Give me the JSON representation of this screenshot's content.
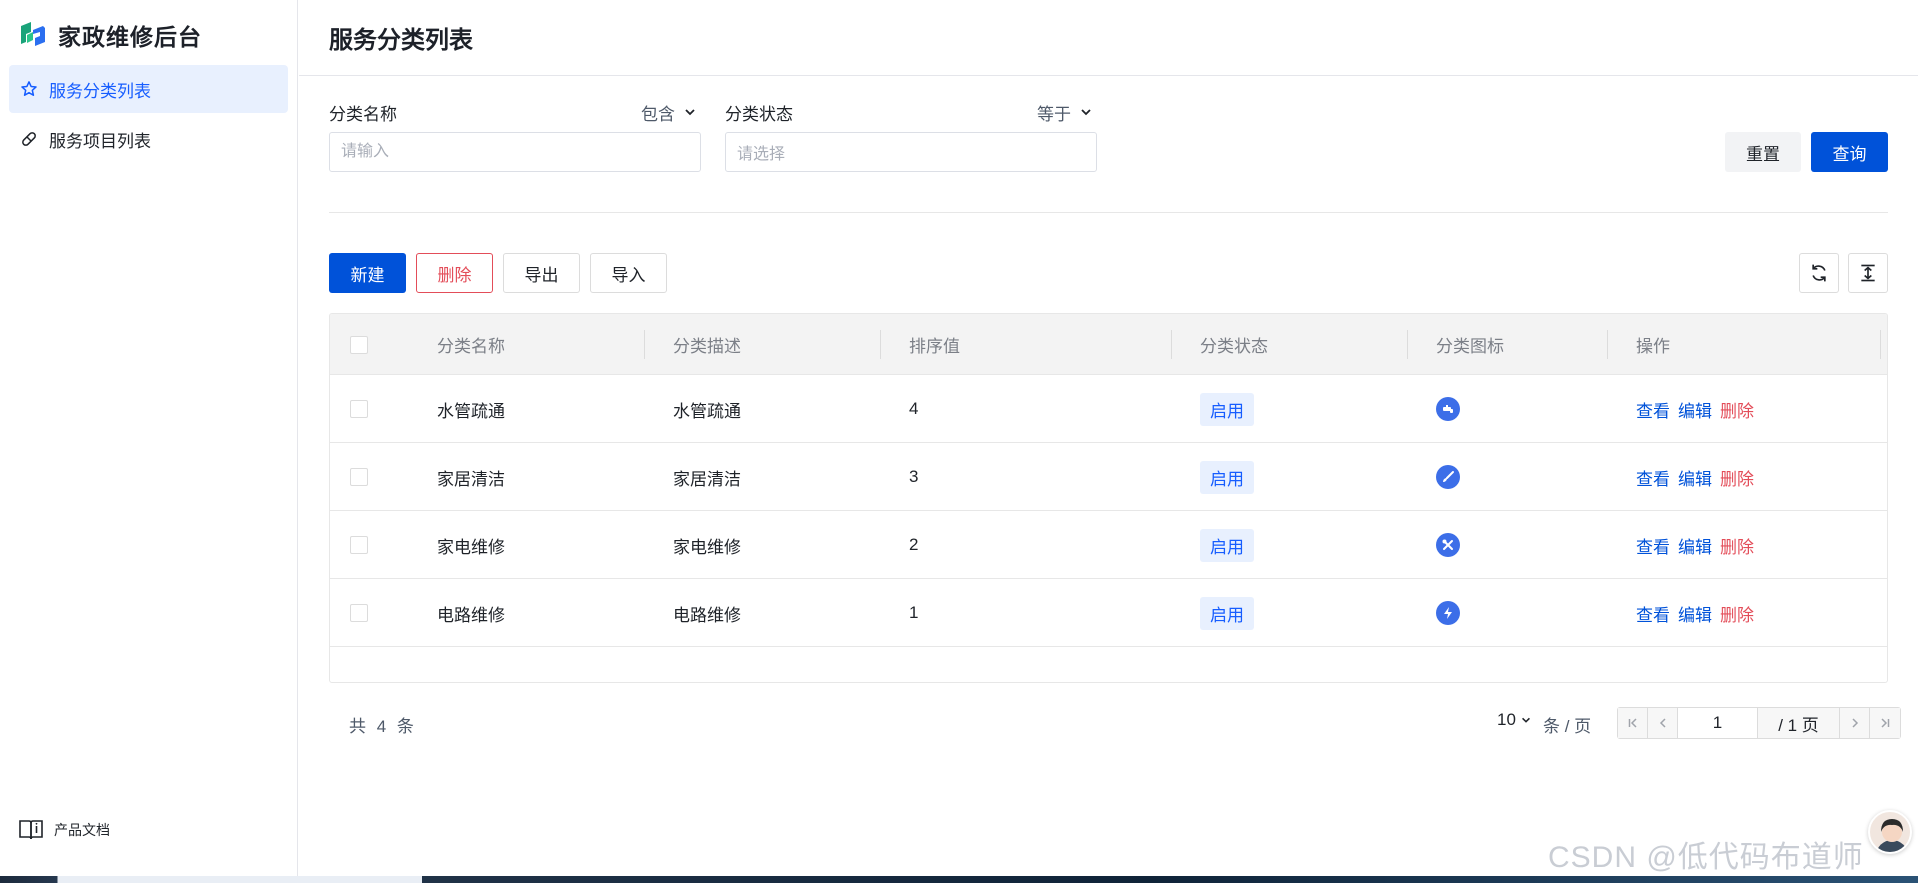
{
  "sidebar": {
    "brand": "家政维修后台",
    "items": [
      {
        "label": "服务分类列表",
        "icon": "star-icon",
        "active": true
      },
      {
        "label": "服务项目列表",
        "icon": "pill-icon",
        "active": false
      }
    ],
    "footer": {
      "label": "产品文档",
      "icon": "book-icon"
    }
  },
  "header": {
    "title": "服务分类列表"
  },
  "filters": {
    "name": {
      "label": "分类名称",
      "operator": "包含",
      "placeholder": "请输入"
    },
    "status": {
      "label": "分类状态",
      "operator": "等于",
      "placeholder": "请选择"
    },
    "reset_label": "重置",
    "query_label": "查询"
  },
  "toolbar": {
    "new_label": "新建",
    "delete_label": "删除",
    "export_label": "导出",
    "import_label": "导入"
  },
  "table": {
    "columns": [
      "分类名称",
      "分类描述",
      "排序值",
      "分类状态",
      "分类图标",
      "操作"
    ],
    "rows": [
      {
        "name": "水管疏通",
        "desc": "水管疏通",
        "sort": "4",
        "status": "启用",
        "icon": "faucet-icon"
      },
      {
        "name": "家居清洁",
        "desc": "家居清洁",
        "sort": "3",
        "status": "启用",
        "icon": "brush-icon"
      },
      {
        "name": "家电维修",
        "desc": "家电维修",
        "sort": "2",
        "status": "启用",
        "icon": "tools-icon"
      },
      {
        "name": "电路维修",
        "desc": "电路维修",
        "sort": "1",
        "status": "启用",
        "icon": "lightning-icon"
      }
    ],
    "actions": {
      "view": "查看",
      "edit": "编辑",
      "delete": "删除"
    }
  },
  "pagination": {
    "total_text": "共 4 条",
    "page_size": "10",
    "page_unit": "条 / 页",
    "current_page": "1",
    "total_pages": "/ 1 页"
  },
  "watermark": "CSDN @低代码布道师",
  "colors": {
    "primary": "#0052d9",
    "danger": "#e34d59",
    "tag_bg": "#e8f0fe",
    "icon_bg": "#3c6ee8"
  }
}
